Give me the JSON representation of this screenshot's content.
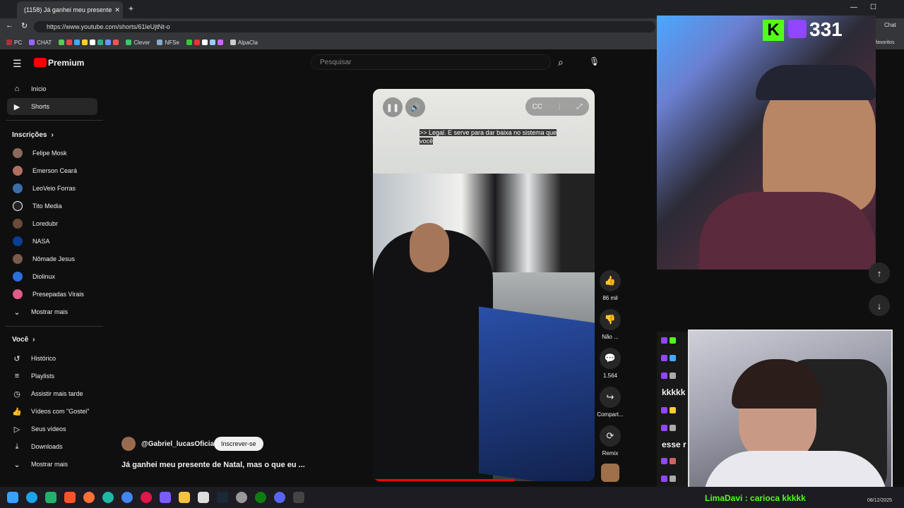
{
  "browser": {
    "tab_title": "(1158) Já ganhei meu presente",
    "url": "https://www.youtube.com/shorts/61leUjtNt-o",
    "bookmarks": [
      "PC",
      "CHAT",
      "Clever",
      "NFSe",
      "AlpaCla"
    ],
    "favorites_label": "favoritos"
  },
  "youtube": {
    "logo": "Premium",
    "search_placeholder": "Pesquisar",
    "nav": {
      "home": "Início",
      "shorts": "Shorts"
    },
    "subs_header": "Inscrições",
    "subscriptions": [
      "Felipe Mosk",
      "Emerson Ceará",
      "LeoVeio Forras",
      "Tito Media",
      "Loredubr",
      "NASA",
      "Nômade Jesus",
      "Diolinux",
      "Presepadas Virais"
    ],
    "show_more": "Mostrar mais",
    "you_header": "Você",
    "you_items": [
      "Histórico",
      "Playlists",
      "Assistir mais tarde",
      "Vídeos com \"Gostei\"",
      "Seus vídeos",
      "Downloads",
      "Mostrar mais"
    ],
    "short": {
      "caption": ">> Legal. E serve para dar baixa no sistema que você",
      "channel": "@Gabriel_lucasOficial",
      "subscribe": "Inscrever-se",
      "title": "Já ganhei meu presente de Natal, mas o que eu ...",
      "likes": "86 mil",
      "dislike": "Não ...",
      "comments": "1.564",
      "share": "Compart...",
      "remix": "Remix"
    }
  },
  "overlay": {
    "viewer_count": "331",
    "chat_label": "Chat",
    "chat_fragments": [
      "kkkkk",
      "esse r"
    ],
    "chat_bottom": "LimaDavi : carioca kkkkk",
    "date": "08/12/2025"
  }
}
